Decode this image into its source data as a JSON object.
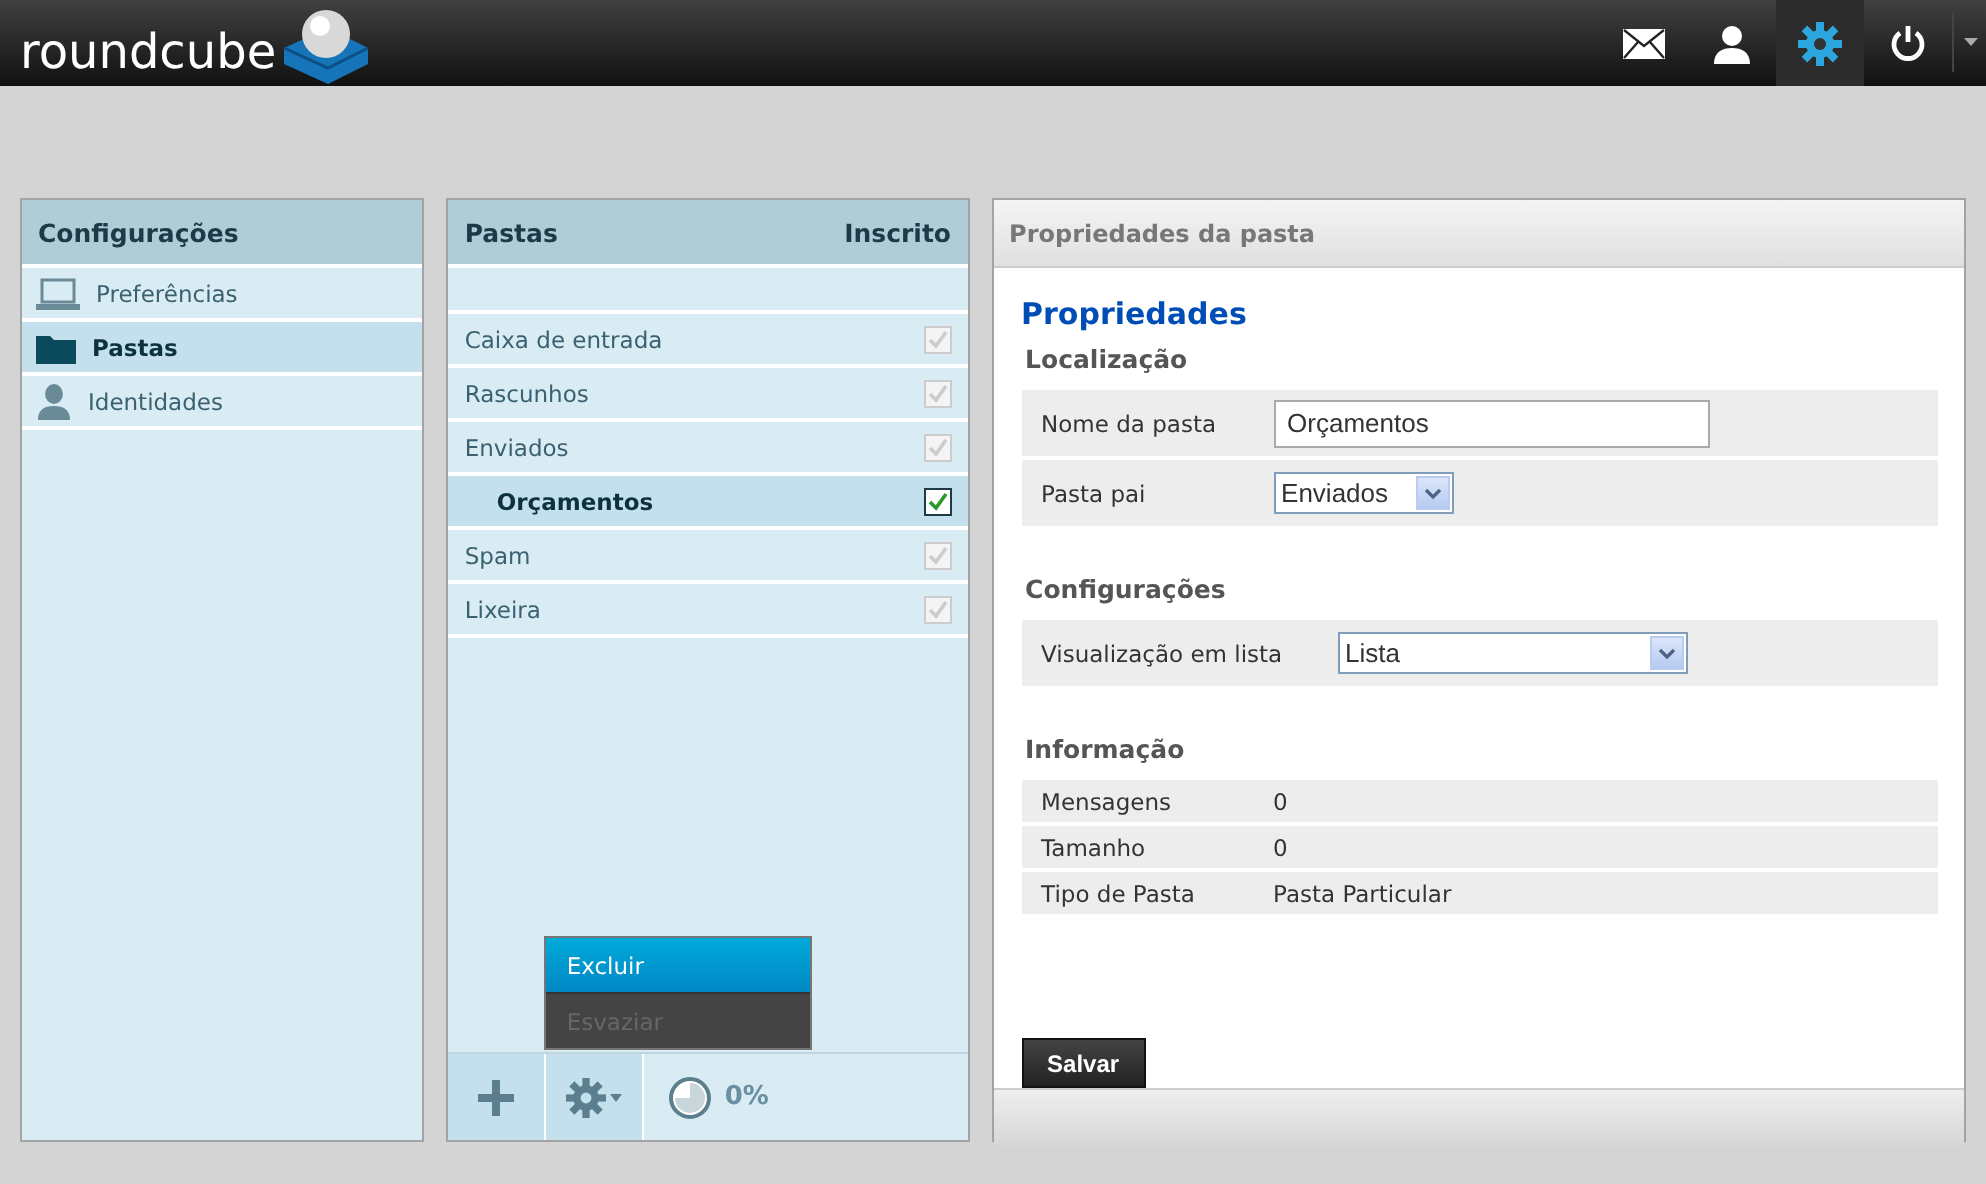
{
  "header": {
    "logo": "roundcube",
    "nav": [
      {
        "kind": "mail",
        "selected": false
      },
      {
        "kind": "contacts",
        "selected": false
      },
      {
        "kind": "settings",
        "selected": true
      },
      {
        "kind": "logout",
        "selected": false
      }
    ]
  },
  "settings_nav": {
    "title": "Configurações",
    "items": [
      {
        "kind": "computer",
        "label": "Preferências",
        "selected": false
      },
      {
        "kind": "folder",
        "label": "Pastas",
        "selected": true
      },
      {
        "kind": "person",
        "label": "Identidades",
        "selected": false
      }
    ]
  },
  "folders": {
    "title": "Pastas",
    "subscribed_title": "Inscrito",
    "items": [
      {
        "name": "Caixa de entrada",
        "subscribed": true,
        "disabled": true,
        "selected": false
      },
      {
        "name": "Rascunhos",
        "subscribed": true,
        "disabled": true,
        "selected": false
      },
      {
        "name": "Enviados",
        "subscribed": true,
        "disabled": true,
        "selected": false,
        "children": [
          {
            "name": "Orçamentos",
            "subscribed": true,
            "disabled": false,
            "selected": true
          }
        ]
      },
      {
        "name": "Spam",
        "subscribed": true,
        "disabled": true,
        "selected": false
      },
      {
        "name": "Lixeira",
        "subscribed": true,
        "disabled": true,
        "selected": false
      }
    ],
    "menu": [
      {
        "label": "Excluir",
        "selected": true,
        "disabled": false
      },
      {
        "label": "Esvaziar",
        "selected": false,
        "disabled": true
      }
    ],
    "quota": "0%"
  },
  "properties": {
    "panel_title": "Propriedades da pasta",
    "title": "Propriedades",
    "sections": [
      {
        "title": "Localização",
        "rows": [
          {
            "kind": "input",
            "label": "Nome da pasta",
            "value": "Orçamentos"
          },
          {
            "kind": "select",
            "label": "Pasta pai",
            "value": "Enviados"
          }
        ]
      },
      {
        "title": "Configurações",
        "rows": [
          {
            "kind": "select-wide",
            "label": "Visualização em lista",
            "value": "Lista"
          }
        ]
      },
      {
        "title": "Informação",
        "rows": [
          {
            "kind": "text",
            "label": "Mensagens",
            "value": "0"
          },
          {
            "kind": "text",
            "label": "Tamanho",
            "value": "0"
          },
          {
            "kind": "text",
            "label": "Tipo de Pasta",
            "value": "Pasta Particular"
          }
        ]
      }
    ],
    "save_button": "Salvar"
  }
}
